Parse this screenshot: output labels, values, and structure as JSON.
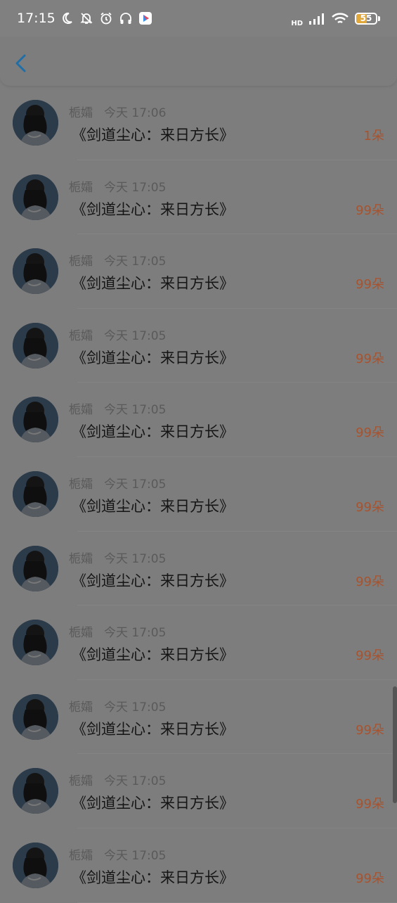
{
  "status_bar": {
    "time": "17:15",
    "network_label": "HD",
    "battery_level": "55",
    "icons": [
      "moon-icon",
      "bell-off-icon",
      "alarm-icon",
      "headphones-icon",
      "app-store-icon",
      "signal-icon",
      "wifi-icon",
      "battery-icon"
    ]
  },
  "header": {
    "back_icon": "chevron-left-icon",
    "accent_color": "#1e6fa8"
  },
  "items": [
    {
      "name": "栀孀",
      "time": "今天 17:06",
      "title": "《剑道尘心：来日方长》",
      "count": "1朵"
    },
    {
      "name": "栀孀",
      "time": "今天 17:05",
      "title": "《剑道尘心：来日方长》",
      "count": "99朵"
    },
    {
      "name": "栀孀",
      "time": "今天 17:05",
      "title": "《剑道尘心：来日方长》",
      "count": "99朵"
    },
    {
      "name": "栀孀",
      "time": "今天 17:05",
      "title": "《剑道尘心：来日方长》",
      "count": "99朵"
    },
    {
      "name": "栀孀",
      "time": "今天 17:05",
      "title": "《剑道尘心：来日方长》",
      "count": "99朵"
    },
    {
      "name": "栀孀",
      "time": "今天 17:05",
      "title": "《剑道尘心：来日方长》",
      "count": "99朵"
    },
    {
      "name": "栀孀",
      "time": "今天 17:05",
      "title": "《剑道尘心：来日方长》",
      "count": "99朵"
    },
    {
      "name": "栀孀",
      "time": "今天 17:05",
      "title": "《剑道尘心：来日方长》",
      "count": "99朵"
    },
    {
      "name": "栀孀",
      "time": "今天 17:05",
      "title": "《剑道尘心：来日方长》",
      "count": "99朵"
    },
    {
      "name": "栀孀",
      "time": "今天 17:05",
      "title": "《剑道尘心：来日方长》",
      "count": "99朵"
    },
    {
      "name": "栀孀",
      "time": "今天 17:05",
      "title": "《剑道尘心：来日方长》",
      "count": "99朵"
    }
  ]
}
